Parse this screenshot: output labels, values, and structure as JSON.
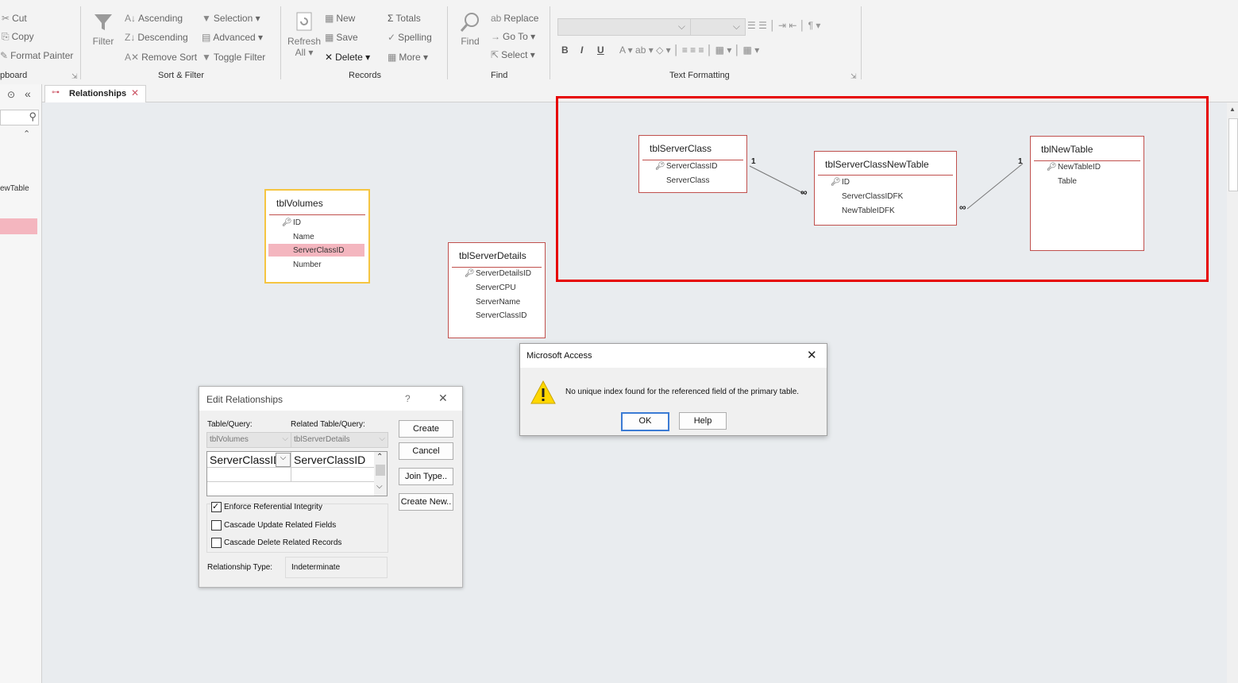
{
  "ribbon": {
    "clipboard": {
      "cut": "Cut",
      "copy": "Copy",
      "format_painter": "Format Painter",
      "group": "pboard"
    },
    "sort_filter": {
      "filter": "Filter",
      "ascending": "Ascending",
      "descending": "Descending",
      "remove_sort": "Remove Sort",
      "selection": "Selection",
      "advanced": "Advanced",
      "toggle_filter": "Toggle Filter",
      "group": "Sort & Filter"
    },
    "records": {
      "refresh": "Refresh",
      "refresh_all": "All",
      "new": "New",
      "save": "Save",
      "delete": "Delete",
      "totals": "Totals",
      "spelling": "Spelling",
      "more": "More",
      "group": "Records"
    },
    "find": {
      "find": "Find",
      "replace": "Replace",
      "goto": "Go To",
      "select": "Select",
      "group": "Find"
    },
    "text_formatting": {
      "bold": "B",
      "italic": "I",
      "underline": "U",
      "group": "Text Formatting"
    }
  },
  "nav": {
    "partial_item": "ewTable"
  },
  "tab": {
    "label": "Relationships"
  },
  "tables": {
    "volumes": {
      "name": "tblVolumes",
      "fields": [
        "ID",
        "Name",
        "ServerClassID",
        "Number"
      ]
    },
    "details": {
      "name": "tblServerDetails",
      "fields": [
        "ServerDetailsID",
        "ServerCPU",
        "ServerName",
        "ServerClassID"
      ]
    },
    "server_class": {
      "name": "tblServerClass",
      "fields": [
        "ServerClassID",
        "ServerClass"
      ]
    },
    "junction": {
      "name": "tblServerClassNewTable",
      "fields": [
        "ID",
        "ServerClassIDFK",
        "NewTableIDFK"
      ]
    },
    "new_table": {
      "name": "tblNewTable",
      "fields": [
        "NewTableID",
        "Table"
      ]
    }
  },
  "relationships": {
    "one": "1",
    "many": "∞"
  },
  "edit_relationships": {
    "title": "Edit Relationships",
    "help": "?",
    "table_query_label": "Table/Query:",
    "related_label": "Related Table/Query:",
    "table_value": "tblVolumes",
    "related_value": "tblServerDetails",
    "left_field": "ServerClassID",
    "right_field": "ServerClassID",
    "enforce": "Enforce Referential Integrity",
    "cascade_update": "Cascade Update Related Fields",
    "cascade_delete": "Cascade Delete Related Records",
    "rel_type_label": "Relationship Type:",
    "rel_type_value": "Indeterminate",
    "buttons": {
      "create": "Create",
      "cancel": "Cancel",
      "join_type": "Join Type..",
      "create_new": "Create New.."
    }
  },
  "message_box": {
    "title": "Microsoft Access",
    "message": "No unique index found for the referenced field of the primary table.",
    "ok": "OK",
    "help": "Help"
  },
  "colors": {
    "highlight": "#e60000",
    "table_border": "#c0504d",
    "selected_table": "#f5c542",
    "field_highlight": "#f4b6bf"
  }
}
